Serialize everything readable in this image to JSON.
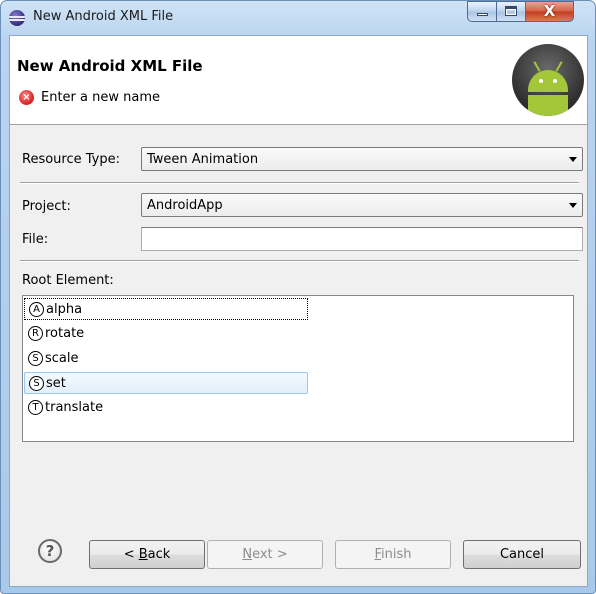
{
  "window": {
    "title": "New Android XML File",
    "close_glyph": "X"
  },
  "header": {
    "title": "New Android XML File",
    "message": "Enter a new name",
    "error_glyph": "×"
  },
  "form": {
    "resource_type_label": "Resource Type:",
    "resource_type_value": "Tween Animation",
    "project_label": "Project:",
    "project_value": "AndroidApp",
    "file_label": "File:",
    "file_value": "",
    "root_element_label": "Root Element:"
  },
  "root_elements": [
    {
      "letter": "A",
      "label": "alpha",
      "state": "focused"
    },
    {
      "letter": "R",
      "label": "rotate",
      "state": "normal"
    },
    {
      "letter": "S",
      "label": "scale",
      "state": "normal"
    },
    {
      "letter": "S",
      "label": "set",
      "state": "selected"
    },
    {
      "letter": "T",
      "label": "translate",
      "state": "normal"
    }
  ],
  "footer": {
    "help_glyph": "?",
    "back": {
      "mnemonic": "B",
      "rest": "ack",
      "prefix": "< "
    },
    "next": {
      "mnemonic": "N",
      "rest": "ext >"
    },
    "finish": {
      "mnemonic": "F",
      "rest": "inish"
    },
    "cancel": "Cancel"
  }
}
